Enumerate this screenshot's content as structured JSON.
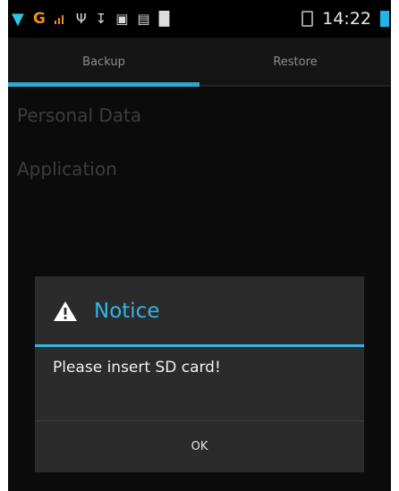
{
  "status_bar": {
    "network_label": "G",
    "time": "14:22"
  },
  "tabs": [
    {
      "label": "Backup",
      "selected": true
    },
    {
      "label": "Restore",
      "selected": false
    }
  ],
  "list": [
    {
      "label": "Personal Data"
    },
    {
      "label": "Application"
    }
  ],
  "dialog": {
    "title": "Notice",
    "message": "Please insert SD card!",
    "ok_label": "OK"
  },
  "colors": {
    "accent": "#33b5e5",
    "background": "#0b0b0b",
    "dialog_bg": "#2b2b2b"
  }
}
